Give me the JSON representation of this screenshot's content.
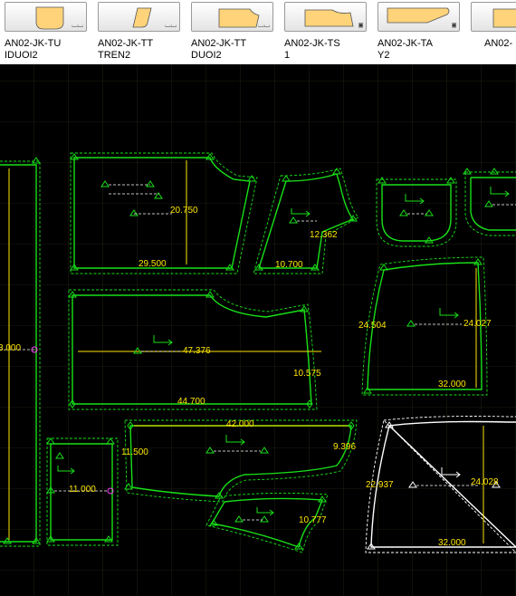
{
  "thumbnails": [
    {
      "label": "AN02-JK-TU\nIDUOI2",
      "mark": "⌴⌴",
      "icon": "piece-thumbnail-icon"
    },
    {
      "label": "AN02-JK-TT\nTREN2",
      "mark": "⌴⌴",
      "icon": "piece-thumbnail-icon"
    },
    {
      "label": "AN02-JK-TT\nDUOI2",
      "mark": "⌴⌴",
      "icon": "piece-thumbnail-icon"
    },
    {
      "label": "AN02-JK-TS\n1",
      "mark": "▣",
      "icon": "piece-thumbnail-icon"
    },
    {
      "label": "AN02-JK-TA\nY2",
      "mark": "▣",
      "icon": "piece-thumbnail-icon"
    },
    {
      "label": "AN02-",
      "mark": "",
      "icon": "piece-thumbnail-icon"
    }
  ],
  "dimensions": {
    "left_long": "3.000",
    "p1_h": "20.750",
    "p1_w": "29.500",
    "p2_h": "12.362",
    "p2_w": "10.700",
    "p3_len": "47.376",
    "p3_side": "10.575",
    "p3_w": "44.700",
    "p4_left": "24.504",
    "p4_right": "24.027",
    "p4_w": "32.000",
    "p5_len": "42.000",
    "p5_left": "11.500",
    "p5_right": "9.396",
    "p6_w": "11.000",
    "p7_w": "10.777",
    "p8_left": "22.937",
    "p8_right": "24.028",
    "p8_w": "32.000"
  },
  "colors": {
    "thumbnail_fill": "#ffd37a",
    "outline": "#18e018",
    "dimension": "#ffe600",
    "selected": "#ffffff",
    "background": "#000000"
  }
}
